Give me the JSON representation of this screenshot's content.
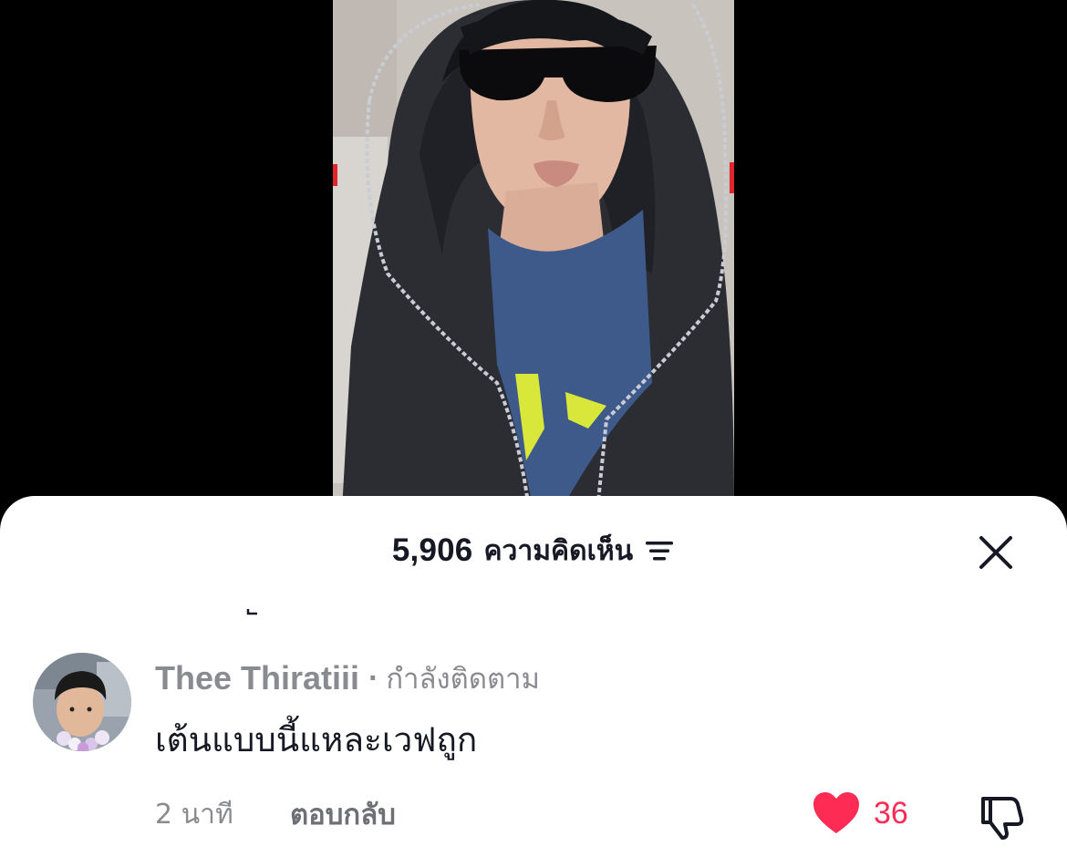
{
  "video": {
    "subject": "person in black hoodie and sunglasses"
  },
  "comments_sheet": {
    "count": "5,906",
    "count_label": "ความคิดเห็น",
    "filter_icon": "filter-lines-icon",
    "close_icon": "close-x-icon"
  },
  "comment": {
    "username": "Thee Thiratiii",
    "separator": "·",
    "follow_status": "กำลังติดตาม",
    "text": "เต้นแบบนี้แหละเวฟถูก",
    "time_ago": "2 นาที",
    "reply_label": "ตอบกลับ",
    "like_count": "36",
    "like_icon": "heart-icon",
    "dislike_icon": "thumbs-down-icon"
  },
  "colors": {
    "like_red": "#fe2c55",
    "muted_gray": "#8a8b91",
    "text_dark": "#161823"
  }
}
